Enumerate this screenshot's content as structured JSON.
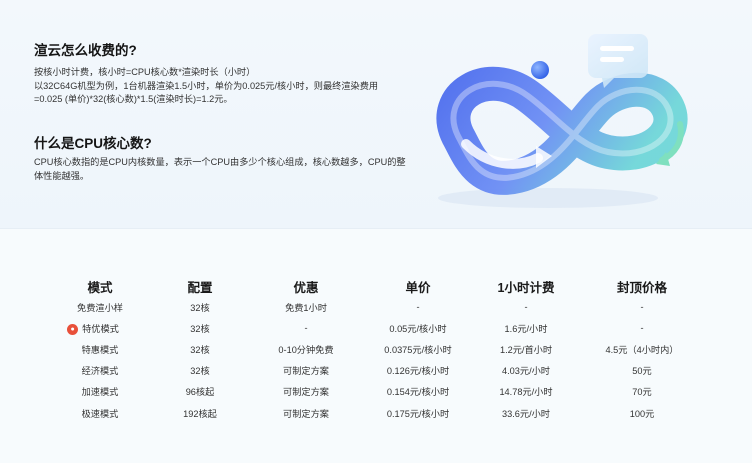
{
  "faq": [
    {
      "title": "渲云怎么收费的?",
      "lines": [
        "按核小时计费，核小时=CPU核心数*渲染时长（小时）",
        "以32C64G机型为例，1台机器渲染1.5小时，单价为0.025元/核小时，则最终渲染费用",
        "=0.025 (单价)*32(核心数)*1.5(渲染时长)=1.2元。"
      ]
    },
    {
      "title": "什么是CPU核心数?",
      "lines": [
        "CPU核心数指的是CPU内核数量，表示一个CPU由多少个核心组成，核心数越多，CPU的整",
        "体性能越强。"
      ]
    }
  ],
  "illustration": {
    "name": "infinity-loop-illustration",
    "colors": [
      "#5a7cf0",
      "#63c8e6",
      "#7ad9c4"
    ]
  },
  "pricing": {
    "headers": [
      "模式",
      "配置",
      "优惠",
      "单价",
      "1小时计费",
      "封顶价格"
    ],
    "rows": [
      {
        "mode": "免费渲小样",
        "hot": false,
        "config": "32核",
        "discount": "免费1小时",
        "unit_price": "-",
        "hourly": "-",
        "cap": "-"
      },
      {
        "mode": "特优模式",
        "hot": true,
        "config": "32核",
        "discount": "-",
        "unit_price": "0.05元/核小时",
        "hourly": "1.6元/小时",
        "cap": "-"
      },
      {
        "mode": "特惠模式",
        "hot": false,
        "config": "32核",
        "discount": "0-10分钟免费",
        "unit_price": "0.0375元/核小时",
        "hourly": "1.2元/首小时",
        "cap": "4.5元（4小时内）"
      },
      {
        "mode": "经济模式",
        "hot": false,
        "config": "32核",
        "discount": "可制定方案",
        "unit_price": "0.126元/核小时",
        "hourly": "4.03元/小时",
        "cap": "50元"
      },
      {
        "mode": "加速模式",
        "hot": false,
        "config": "96核起",
        "discount": "可制定方案",
        "unit_price": "0.154元/核小时",
        "hourly": "14.78元/小时",
        "cap": "70元"
      },
      {
        "mode": "极速模式",
        "hot": false,
        "config": "192核起",
        "discount": "可制定方案",
        "unit_price": "0.175元/核小时",
        "hourly": "33.6元/小时",
        "cap": "100元"
      }
    ]
  }
}
